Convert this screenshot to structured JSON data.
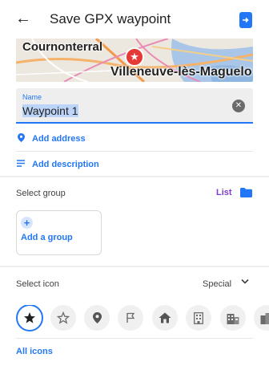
{
  "header": {
    "back_icon": "arrow-back-icon",
    "title": "Save GPX waypoint",
    "save_icon": "save-to-file-icon"
  },
  "map": {
    "label_a": "Cournonterral",
    "label_b": "Villeneuve-lès-Maguelo",
    "pin_icon": "star-icon"
  },
  "name_field": {
    "label": "Name",
    "value": "Waypoint 1"
  },
  "actions": {
    "add_address": "Add address",
    "add_description": "Add description"
  },
  "group": {
    "title": "Select group",
    "list_label": "List",
    "add_label": "Add a group"
  },
  "icon_section": {
    "title": "Select icon",
    "category": "Special",
    "icons": [
      "star-filled-icon",
      "star-outline-icon",
      "location-pin-icon",
      "flag-icon",
      "home-icon",
      "office-building-icon",
      "apartment-building-icon",
      "city-icon"
    ],
    "selected_index": 0,
    "all_icons_label": "All icons"
  },
  "colors": {
    "accent": "#2377f6",
    "list_link": "#7b3fd0",
    "pin": "#e53935"
  }
}
